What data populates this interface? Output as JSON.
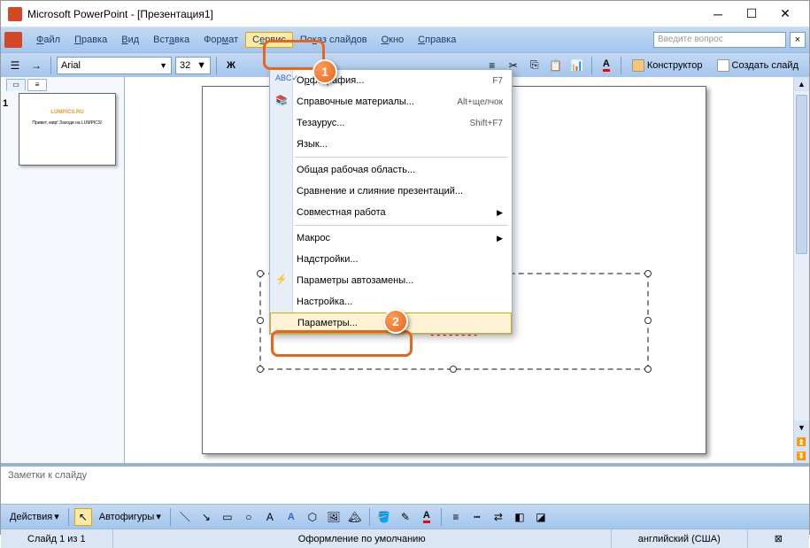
{
  "window": {
    "title": "Microsoft PowerPoint - [Презентация1]"
  },
  "menubar": {
    "file": "Файл",
    "edit": "Правка",
    "view": "Вид",
    "insert": "Вставка",
    "format": "Формат",
    "tools": "Сервис",
    "slideshow": "Показ слайдов",
    "window": "Окно",
    "help": "Справка",
    "search_placeholder": "Введите вопрос"
  },
  "toolbar": {
    "font": "Arial",
    "size": "32",
    "designer": "Конструктор",
    "newslide": "Создать слайд"
  },
  "dropdown": {
    "items": [
      {
        "label": "Орфография...",
        "shortcut": "F7",
        "u": 0
      },
      {
        "label": "Справочные материалы...",
        "shortcut": "Alt+щелчок"
      },
      {
        "label": "Тезаурус...",
        "shortcut": "Shift+F7"
      },
      {
        "label": "Язык..."
      },
      {
        "sep": true
      },
      {
        "label": "Общая рабочая область..."
      },
      {
        "label": "Сравнение и слияние презентаций..."
      },
      {
        "label": "Совместная работа",
        "arrow": true
      },
      {
        "sep": true
      },
      {
        "label": "Макрос",
        "arrow": true
      },
      {
        "label": "Надстройки..."
      },
      {
        "label": "Параметры автозамены..."
      },
      {
        "label": "Настройка..."
      },
      {
        "label": "Параметры...",
        "hl": true
      }
    ]
  },
  "slide": {
    "title": "LUMPICS.RU",
    "sub1": "Привет, мир! Заходи на",
    "sub1_partial": "ди на",
    "sub2": "LUMPICS!"
  },
  "thumb": {
    "num": "1",
    "t1": "LUMPICS.RU",
    "t2": "Привет, мир! Заходи на LUMPICS!"
  },
  "notes": {
    "placeholder": "Заметки к слайду"
  },
  "drawbar": {
    "actions": "Действия",
    "autoshapes": "Автофигуры"
  },
  "statusbar": {
    "slide": "Слайд 1 из 1",
    "design": "Оформление по умолчанию",
    "lang": "английский (США)"
  },
  "callouts": {
    "one": "1",
    "two": "2"
  }
}
